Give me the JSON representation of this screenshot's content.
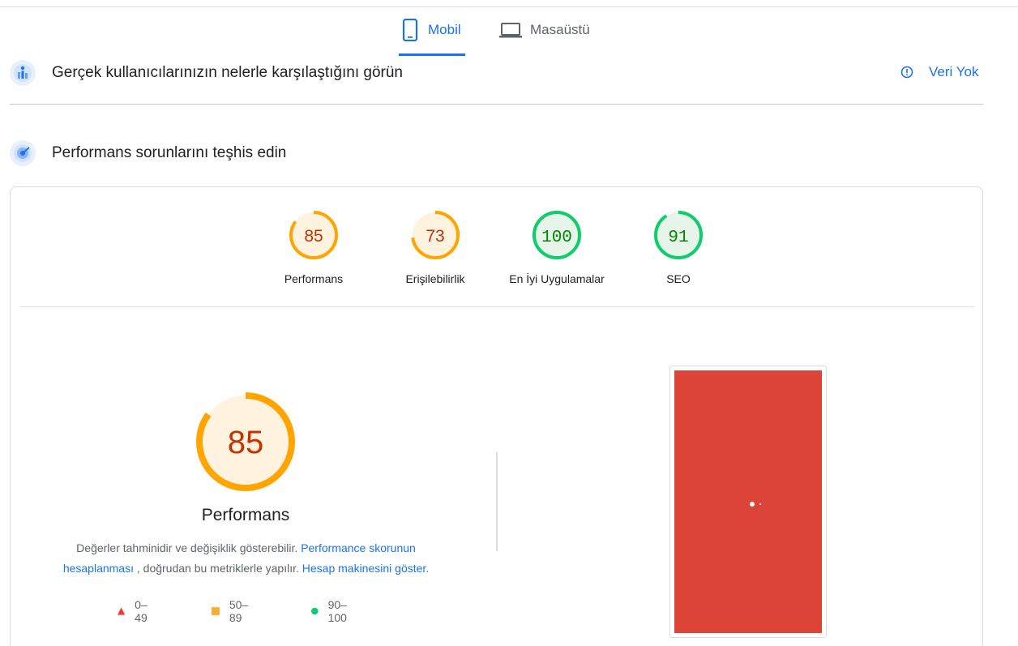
{
  "tabs": {
    "mobile_label": "Mobil",
    "desktop_label": "Masaüstü",
    "active": "Mobil",
    "mobile_icon": "smartphone-icon",
    "desktop_icon": "laptop-icon"
  },
  "field_section": {
    "title": "Gerçek kullanıcılarınızın nelerle karşılaştığını görün",
    "icon": "field-data-icon",
    "status_label": "Veri Yok",
    "status_icon": "info-icon"
  },
  "lab_section": {
    "title": "Performans sorunlarını teşhis edin",
    "icon": "diagnose-icon"
  },
  "scores": [
    {
      "label": "Performans",
      "value": "85",
      "color": "#ffa400",
      "text_color": "#c33300",
      "bg": "#fff3e0"
    },
    {
      "label": "Erişilebilirlik",
      "value": "73",
      "color": "#ffa400",
      "text_color": "#c33300",
      "bg": "#fff3e0"
    },
    {
      "label": "En İyi Uygulamalar",
      "value": "100",
      "color": "#0cce6b",
      "text_color": "#008800",
      "bg": "#e6f4ea"
    },
    {
      "label": "SEO",
      "value": "91",
      "color": "#0cce6b",
      "text_color": "#008800",
      "bg": "#e6f4ea"
    }
  ],
  "main_score": {
    "value": "85",
    "title": "Performans",
    "desc_prefix": "Değerler tahminidir ve değişiklik gösterebilir.",
    "link1": "Performance skorunun hesaplanması",
    "desc_mid": ", doğrudan bu metriklerle yapılır.",
    "link2": "Hesap makinesini göster",
    "desc_suffix": "."
  },
  "legend": [
    {
      "shape": "triangle",
      "range": "0–49",
      "color": "#ff3333"
    },
    {
      "shape": "square",
      "range": "50–89",
      "color": "#ffaa33"
    },
    {
      "shape": "circle",
      "range": "90–100",
      "color": "#0cce6b"
    }
  ],
  "screenshot": {
    "bg_color": "#db4437"
  }
}
